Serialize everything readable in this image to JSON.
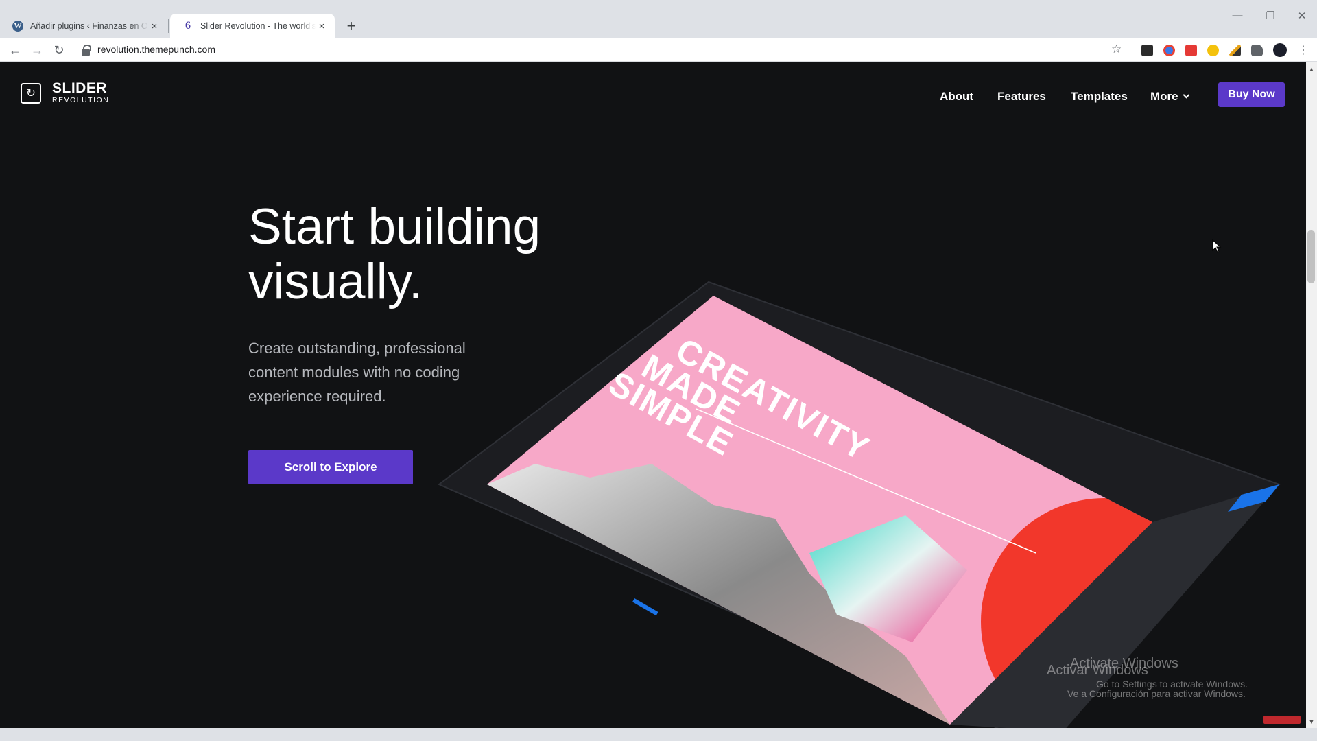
{
  "browser": {
    "tabs": [
      {
        "title": "Añadir plugins ‹ Finanzas en Orden",
        "favicon": "wordpress-icon",
        "active": false
      },
      {
        "title": "Slider Revolution - The world's most",
        "favicon": "slider-revolution-icon",
        "active": true
      }
    ],
    "favicon_glyphs": {
      "wordpress": "W",
      "slider": "6"
    },
    "new_tab_glyph": "+",
    "close_glyph": "×",
    "window_controls": {
      "minimize": "—",
      "maximize": "❐",
      "close": "✕"
    },
    "nav_glyphs": {
      "back": "←",
      "forward": "→",
      "reload": "↻",
      "star": "☆",
      "menu": "⋮"
    },
    "address": "revolution.themepunch.com",
    "extensions": [
      "gmail-icon",
      "chrome-ext-icon",
      "red-ext-icon",
      "yellow-ext-icon",
      "pen-ext-icon",
      "puzzle-icon",
      "profile-avatar"
    ]
  },
  "site": {
    "logo": {
      "main": "SLIDER",
      "sub": "REVOLUTION"
    },
    "nav": [
      {
        "label": "About"
      },
      {
        "label": "Features"
      },
      {
        "label": "Templates"
      },
      {
        "label": "More"
      }
    ],
    "buy_label": "Buy Now",
    "hero": {
      "title_line1": "Start building",
      "title_line2": "visually.",
      "subtitle": "Create outstanding, professional content modules with no coding experience required.",
      "cta_label": "Scroll to Explore"
    },
    "mockup": {
      "headline_line1": "CREATIVITY",
      "headline_line2": "MADE",
      "headline_line3": "SIMPLE",
      "colors": {
        "canvas": "#f7a8c8",
        "accent_red": "#f2372b",
        "panel": "#2a2c31",
        "blue": "#1a73e8"
      }
    },
    "colors": {
      "background": "#111214",
      "accent": "#5b39c9"
    }
  },
  "overlay": {
    "activate_en_1": "Activate Windows",
    "activate_en_2": "Go to Settings to activate Windows.",
    "activate_es_1": "Activar Windows",
    "activate_es_2": "Ve a Configuración para activar Windows."
  }
}
